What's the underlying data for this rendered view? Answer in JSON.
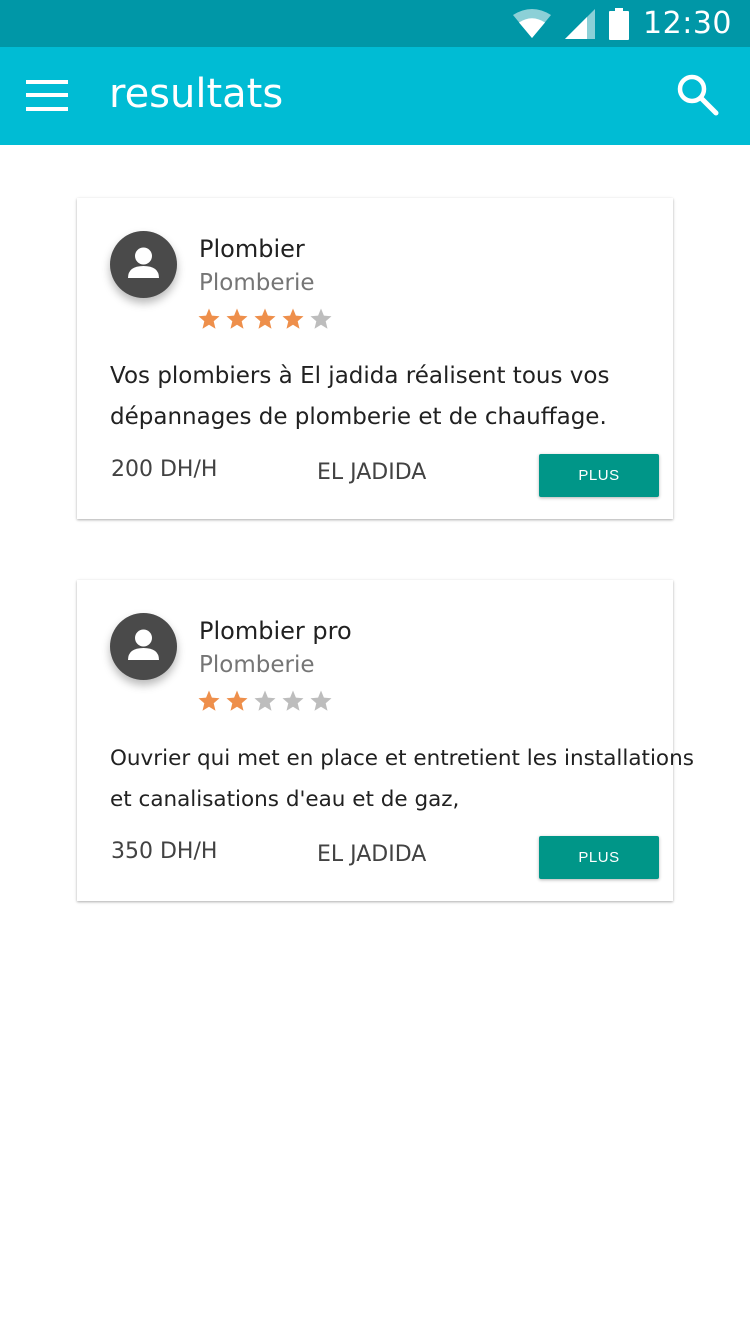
{
  "status_bar": {
    "time": "12:30",
    "icons": [
      "wifi-icon",
      "signal-icon",
      "battery-icon"
    ]
  },
  "app_bar": {
    "title": "resultats",
    "menu_icon": "menu-icon",
    "search_icon": "search-icon"
  },
  "colors": {
    "status_bar": "#0097A7",
    "app_bar": "#00BCD4",
    "button": "#009688",
    "star_filled": "#EE8F4B",
    "star_empty": "#BDBDBD"
  },
  "results": [
    {
      "name": "Plombier",
      "category": "Plomberie",
      "rating": 4,
      "rating_max": 5,
      "description_lines": [
        "Vos plombiers à El jadida réalisent tous vos",
        "dépannages de plomberie et de chauffage."
      ],
      "price": "200 DH/H",
      "city": "EL JADIDA",
      "button_label": "PLUS"
    },
    {
      "name": "Plombier pro",
      "category": "Plomberie",
      "rating": 2,
      "rating_max": 5,
      "description_lines": [
        "Ouvrier qui met en place et entretient les installations",
        "et canalisations d'eau et de gaz,"
      ],
      "price": "350 DH/H",
      "city": "EL JADIDA",
      "button_label": "PLUS"
    }
  ]
}
